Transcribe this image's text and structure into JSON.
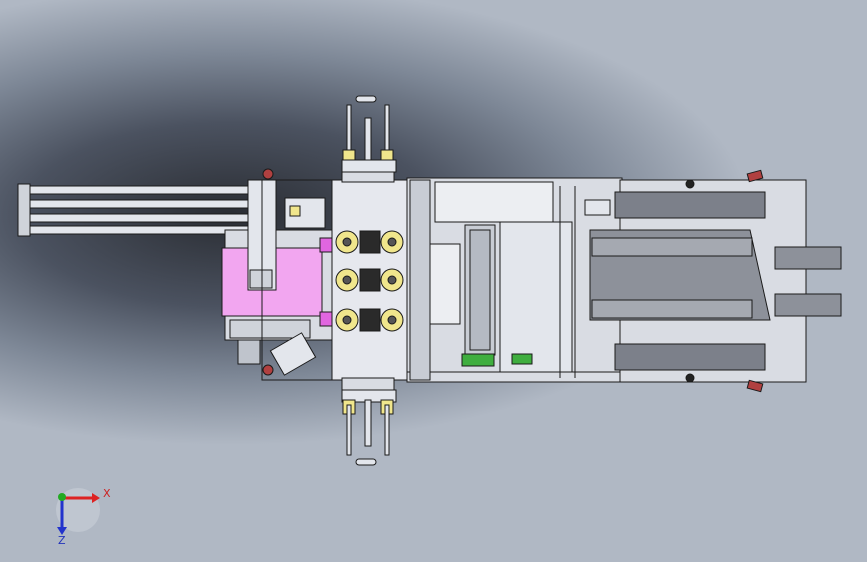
{
  "view": {
    "background_color": "#b4bcc8",
    "shadow_color": "#2a2d33",
    "part_color": "#d9dce3",
    "part_edge_color": "#1a1a1a",
    "highlight_color": "#f2a6f0",
    "bearing_color": "#f0e68c"
  },
  "triad": {
    "x_label": "X",
    "z_label": "Z",
    "x_color": "#dd2222",
    "y_color": "#22aa22",
    "z_color": "#2233cc"
  }
}
